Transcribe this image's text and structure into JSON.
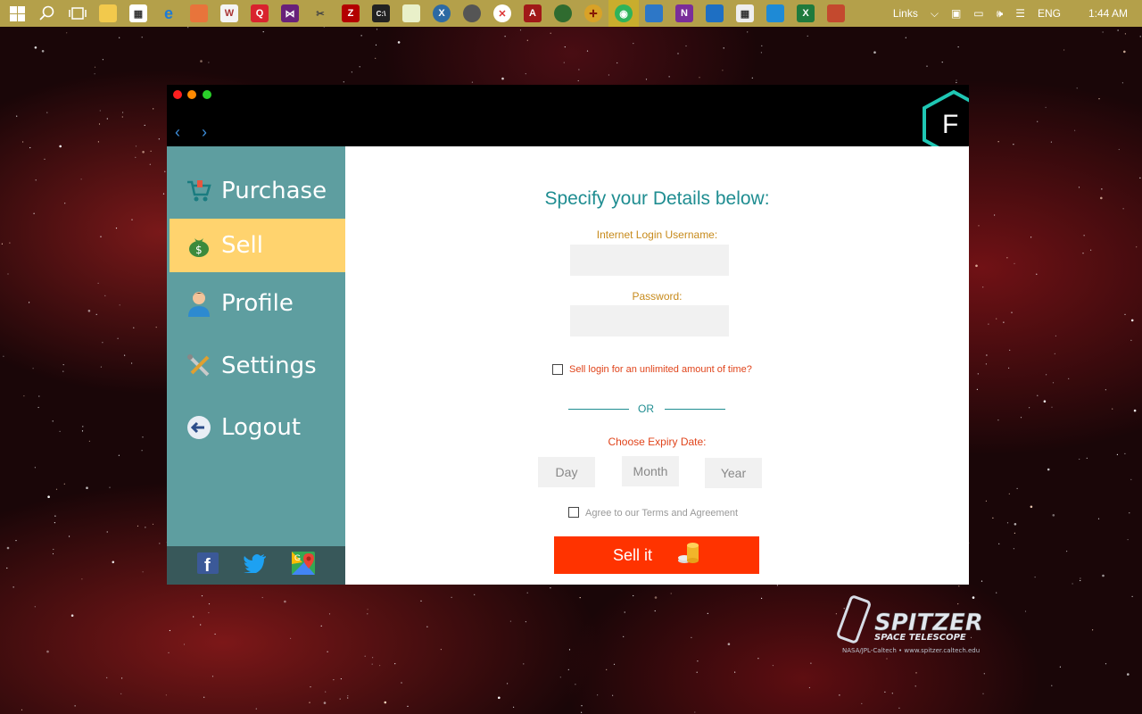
{
  "taskbar": {
    "links_label": "Links",
    "lang": "ENG",
    "time": "1:44 AM"
  },
  "sidebar": {
    "items": [
      {
        "label": "Purchase",
        "icon": "cart-icon"
      },
      {
        "label": "Sell",
        "icon": "money-bag-icon"
      },
      {
        "label": "Profile",
        "icon": "user-icon"
      },
      {
        "label": "Settings",
        "icon": "tools-icon"
      },
      {
        "label": "Logout",
        "icon": "logout-icon"
      }
    ],
    "active": "Sell"
  },
  "logo_letter": "F",
  "form": {
    "heading": "Specify your Details below:",
    "username_label": "Internet Login Username:",
    "username_value": "",
    "password_label": "Password:",
    "password_value": "",
    "unlimited_label": "Sell login for an unlimited amount of time?",
    "or_text": "OR",
    "expiry_label": "Choose Expiry Date:",
    "day": "Day",
    "month": "Month",
    "year": "Year",
    "terms_label": "Agree to our Terms and Agreement",
    "sell_button": "Sell it"
  },
  "watermark": {
    "title": "SPITZER",
    "subtitle": "SPACE TELESCOPE",
    "credit": "NASA/JPL-Caltech • www.spitzer.caltech.edu"
  },
  "colors": {
    "sidebar": "#5e9ea0",
    "active_item": "#ffd36e",
    "accent_teal": "#1f8d91",
    "label_gold": "#c78a1b",
    "label_red": "#e0441b",
    "sell_button": "#ff3300",
    "taskbar": "#b4a04a"
  }
}
